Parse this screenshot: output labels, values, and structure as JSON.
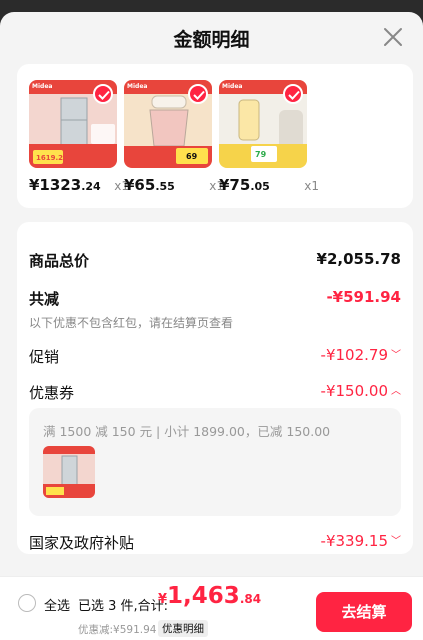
{
  "header": {
    "title": "金额明细"
  },
  "products": [
    {
      "price_int": "¥1323",
      "price_dec": ".24",
      "qty": "x1",
      "brand": "Midea",
      "tag": "1619.2",
      "theme": "fridge"
    },
    {
      "price_int": "¥65",
      "price_dec": ".55",
      "qty": "x1",
      "brand": "Midea",
      "tag": "69",
      "theme": "chopper"
    },
    {
      "price_int": "¥75",
      "price_dec": ".05",
      "qty": "x1",
      "brand": "Midea",
      "tag": "79",
      "theme": "blender"
    }
  ],
  "summary": {
    "goods_total_label": "商品总价",
    "goods_total_value": "¥2,055.78",
    "reduce_label": "共减",
    "reduce_value": "-¥591.94",
    "reduce_note": "以下优惠不包含红包，请在结算页查看",
    "promo_label": "促销",
    "promo_value": "-¥102.79",
    "coupon_label": "优惠券",
    "coupon_value": "-¥150.00",
    "coupon_detail": "满 1500 减 150 元 | 小计 1899.00，已减 150.00",
    "subsidy_label": "国家及政府补贴",
    "subsidy_value": "-¥339.15"
  },
  "footer": {
    "select_all": "全选",
    "selected_text": "已选 3 件,合计:",
    "total_symbol": "¥",
    "total_int": "1,463",
    "total_dec": ".84",
    "saved_text": "优惠减:¥591.94",
    "detail_tag": "优惠明细",
    "pay_button": "去结算"
  },
  "colors": {
    "accent": "#ff2442",
    "background": "#f4f4f4",
    "card": "#ffffff"
  }
}
